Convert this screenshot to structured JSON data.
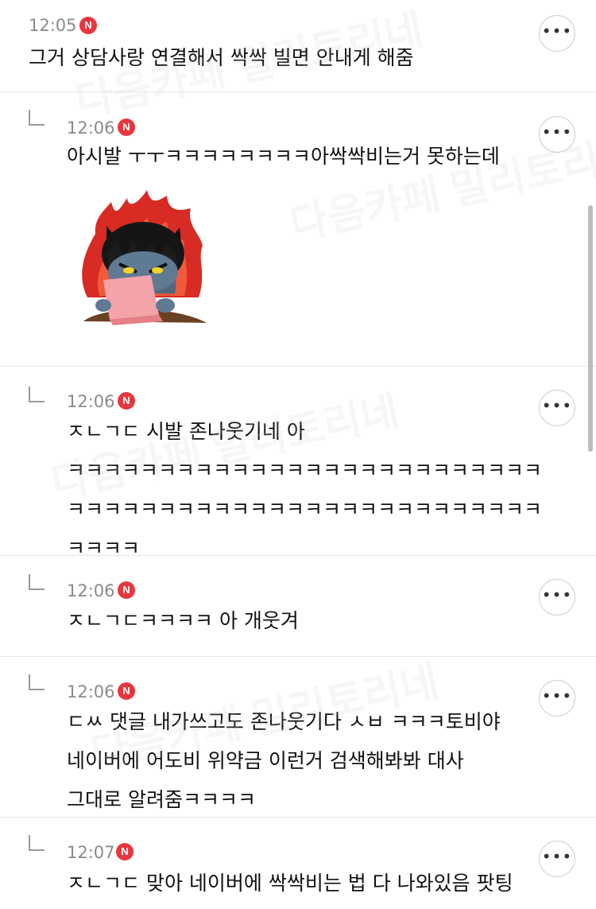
{
  "comments": [
    {
      "time": "12:05",
      "badge": "N",
      "lines": [
        "그거 상담사랑 연결해서 싹싹 빌면 안내게 해줌"
      ]
    },
    {
      "time": "12:06",
      "badge": "N",
      "lines": [
        "아시발 ㅜㅜㅋㅋㅋㅋㅋㅋㅋㅋ아싹싹비는거 못하는데"
      ],
      "sticker": "angry-cat-laptop-sticker"
    },
    {
      "time": "12:06",
      "badge": "N",
      "lines": [
        "ㅈㄴㄱㄷ 시발 존나웃기네 아",
        "ㅋㅋㅋㅋㅋㅋㅋㅋㅋㅋㅋㅋㅋㅋㅋㅋㅋㅋㅋㅋㅋㅋㅋㅋㅋㅋ",
        "ㅋㅋㅋㅋㅋㅋㅋㅋㅋㅋㅋㅋㅋㅋㅋㅋㅋㅋㅋㅋㅋㅋㅋㅋㅋㅋ",
        "ㅋㅋㅋㅋ"
      ]
    },
    {
      "time": "12:06",
      "badge": "N",
      "lines": [
        "ㅈㄴㄱㄷㅋㅋㅋㅋ 아 개웃겨"
      ]
    },
    {
      "time": "12:06",
      "badge": "N",
      "lines": [
        "ㄷㅆ 댓글 내가쓰고도 존나웃기다 ㅅㅂ ㅋㅋㅋ토비야",
        "네이버에 어도비 위약금 이런거 검색해봐봐 대사",
        "그대로 알려줌ㅋㅋㅋㅋ"
      ]
    },
    {
      "time": "12:07",
      "badge": "N",
      "lines": [
        "ㅈㄴㄱㄷ 맞아 네이버에 싹싹비는 법 다 나와있음 팟팅"
      ]
    }
  ],
  "more_label": "•••",
  "watermark": "다음카페 밀리토리네",
  "colors": {
    "badge": "#e8363d",
    "time": "#8b8b8b",
    "text": "#111111",
    "divider": "#e6e6e6"
  }
}
